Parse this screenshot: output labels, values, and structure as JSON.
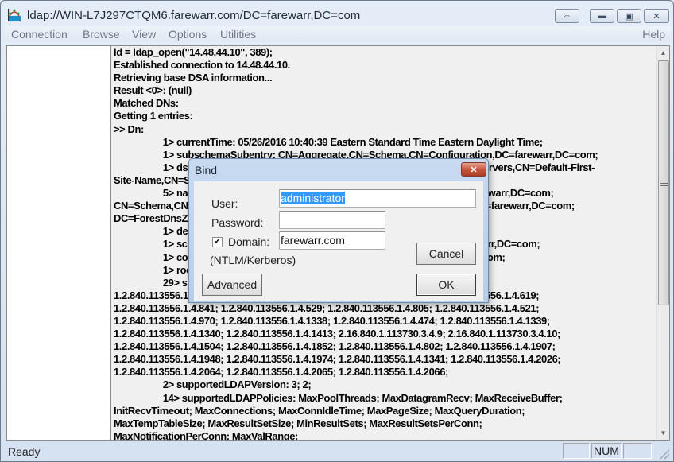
{
  "window": {
    "title": "ldap://WIN-L7J297CTQM6.farewarr.com/DC=farewarr,DC=com",
    "caption_buttons": {
      "restore_down": "⇔",
      "minimize": "▬",
      "maximize": "▣",
      "close": "✕"
    }
  },
  "menu": {
    "items": [
      "Connection",
      "Browse",
      "View",
      "Options",
      "Utilities"
    ],
    "help": "Help"
  },
  "log": {
    "lines": [
      {
        "text": "ld = ldap_open(\"14.48.44.10\", 389);",
        "indent": 0
      },
      {
        "text": "Established connection to 14.48.44.10.",
        "indent": 0
      },
      {
        "text": "Retrieving base DSA information...",
        "indent": 0
      },
      {
        "text": "Result <0>: (null)",
        "indent": 0
      },
      {
        "text": "Matched DNs:",
        "indent": 0
      },
      {
        "text": "Getting 1 entries:",
        "indent": 0
      },
      {
        "text": ">> Dn:",
        "indent": 0
      },
      {
        "text": "1> currentTime: 05/26/2016 10:40:39 Eastern Standard Time Eastern Daylight Time;",
        "indent": 1
      },
      {
        "text": "1> subschemaSubentry: CN=Aggregate,CN=Schema,CN=Configuration,DC=farewarr,DC=com;",
        "indent": 1
      },
      {
        "text": "1> dsServiceName: CN=NTDS Settings,CN=WIN-L7J297CTQM6,CN=Servers,CN=Default-First-",
        "indent": 1
      },
      {
        "text": "Site-Name,CN=Sites,CN=Configuration,DC=farewarr,DC=com;",
        "indent": 0
      },
      {
        "text": "5> namingContexts: DC=farewarr,DC=com; CN=Configuration,DC=farewarr,DC=com;",
        "indent": 1
      },
      {
        "text": "CN=Schema,CN=Configuration,DC=farewarr,DC=com; DC=DomainDnsZones,DC=farewarr,DC=com;",
        "indent": 0
      },
      {
        "text": "DC=ForestDnsZones,DC=farewarr,DC=com;",
        "indent": 0
      },
      {
        "text": "1> defaultNamingContext: DC=farewarr,DC=com;",
        "indent": 1
      },
      {
        "text": "1> schemaNamingContext: CN=Schema,CN=Configuration,DC=farewarr,DC=com;",
        "indent": 1
      },
      {
        "text": "1> configurationNamingContext: CN=Configuration,DC=farewarr,DC=com;",
        "indent": 1
      },
      {
        "text": "1> rootDomainNamingContext: DC=farewarr,DC=com;",
        "indent": 1
      },
      {
        "text": "29> supportedControl: 1.2.840.113556.1.4.319; 1.2.840.113556.1.4.801;",
        "indent": 1
      },
      {
        "text": "1.2.840.113556.1.4.473; 1.2.840.113556.1.4.528; 1.2.840.113556.1.4.417; 1.2.840.113556.1.4.619;",
        "indent": 0
      },
      {
        "text": "1.2.840.113556.1.4.841; 1.2.840.113556.1.4.529; 1.2.840.113556.1.4.805; 1.2.840.113556.1.4.521;",
        "indent": 0
      },
      {
        "text": "1.2.840.113556.1.4.970; 1.2.840.113556.1.4.1338; 1.2.840.113556.1.4.474; 1.2.840.113556.1.4.1339;",
        "indent": 0
      },
      {
        "text": "1.2.840.113556.1.4.1340; 1.2.840.113556.1.4.1413; 2.16.840.1.113730.3.4.9; 2.16.840.1.113730.3.4.10;",
        "indent": 0
      },
      {
        "text": "1.2.840.113556.1.4.1504; 1.2.840.113556.1.4.1852; 1.2.840.113556.1.4.802; 1.2.840.113556.1.4.1907;",
        "indent": 0
      },
      {
        "text": "1.2.840.113556.1.4.1948; 1.2.840.113556.1.4.1974; 1.2.840.113556.1.4.1341; 1.2.840.113556.1.4.2026;",
        "indent": 0
      },
      {
        "text": "1.2.840.113556.1.4.2064; 1.2.840.113556.1.4.2065; 1.2.840.113556.1.4.2066;",
        "indent": 0
      },
      {
        "text": "2> supportedLDAPVersion: 3; 2;",
        "indent": 1
      },
      {
        "text": "14> supportedLDAPPolicies: MaxPoolThreads; MaxDatagramRecv; MaxReceiveBuffer;",
        "indent": 1
      },
      {
        "text": "InitRecvTimeout; MaxConnections; MaxConnIdleTime; MaxPageSize; MaxQueryDuration;",
        "indent": 0
      },
      {
        "text": "MaxTempTableSize; MaxResultSetSize; MinResultSets; MaxResultSetsPerConn;",
        "indent": 0
      },
      {
        "text": "MaxNotificationPerConn; MaxValRange;",
        "indent": 0
      }
    ]
  },
  "scrollbar": {
    "up_arrow": "▲",
    "down_arrow": "▼"
  },
  "statusbar": {
    "text": "Ready",
    "indicators": [
      "",
      "NUM",
      ""
    ]
  },
  "bind_dialog": {
    "title": "Bind",
    "close": "✕",
    "user_label": "User:",
    "user_value": "administrator",
    "password_label": "Password:",
    "password_value": "",
    "domain_checkbox_checked": true,
    "domain_check_glyph": "✔",
    "domain_label": "Domain:",
    "domain_value": "farewarr.com",
    "auth_note": "(NTLM/Kerberos)",
    "cancel_label": "Cancel",
    "ok_label": "OK",
    "advanced_label": "Advanced"
  }
}
